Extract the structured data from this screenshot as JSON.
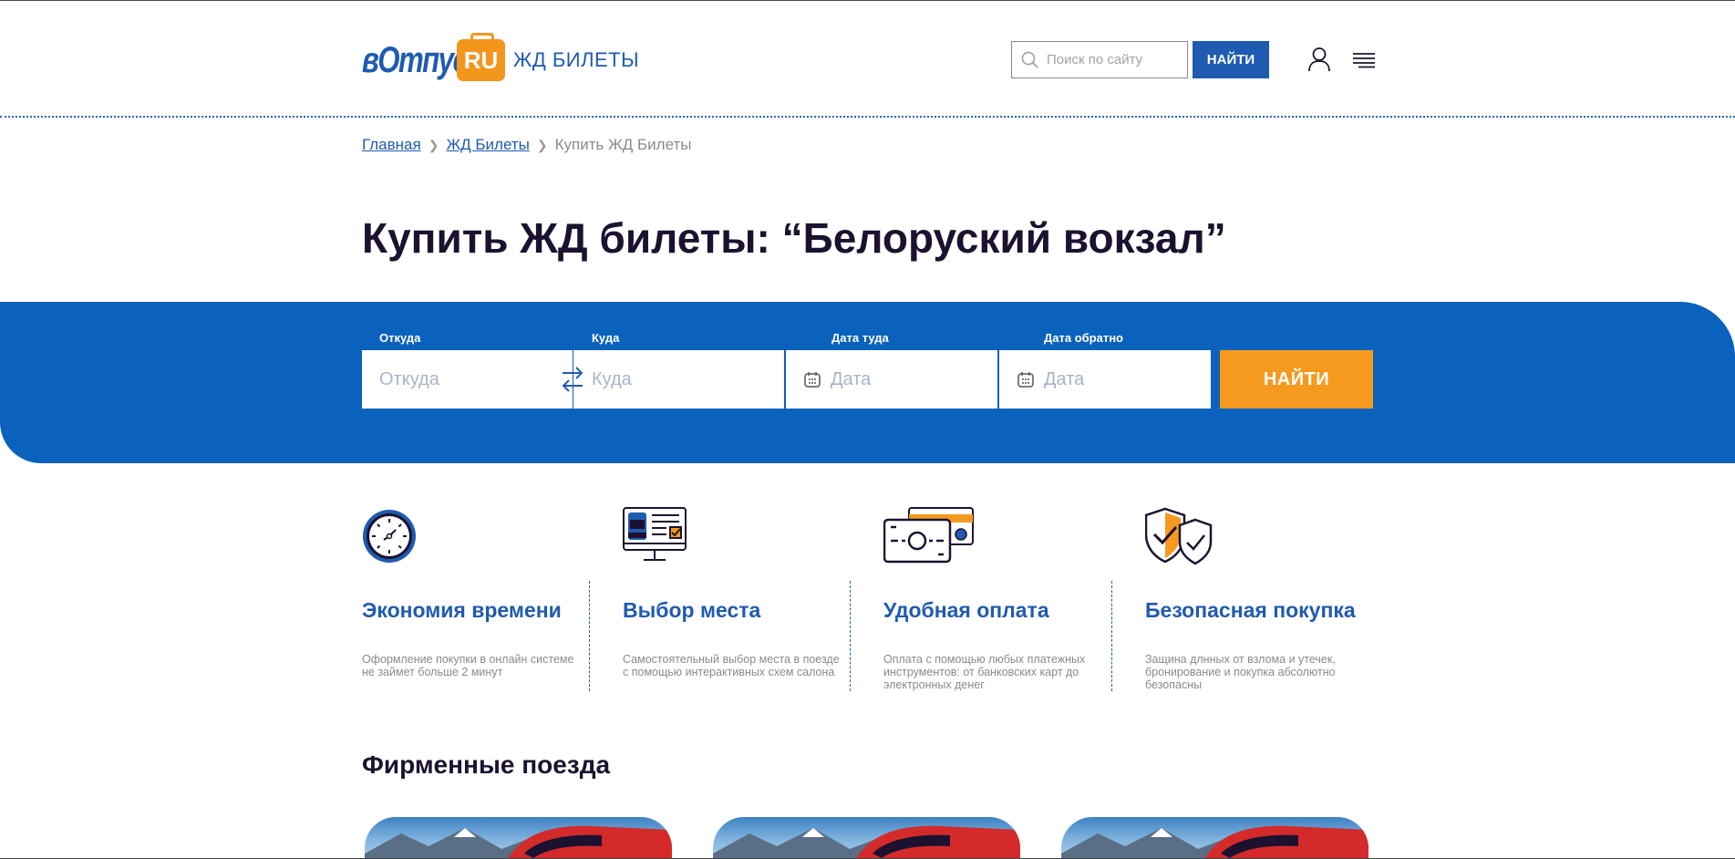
{
  "header": {
    "logo_word": "вОтпуск",
    "logo_badge": "RU",
    "logo_sub": "ЖД БИЛЕТЫ",
    "search_placeholder": "Поиск по сайту",
    "search_button": "НАЙТИ"
  },
  "breadcrumbs": [
    "Главная",
    "ЖД Билеты",
    "Купить ЖД Билеты"
  ],
  "page_title": "Купить ЖД билеты: “Белоруский вокзал”",
  "search_form": {
    "from_label": "Откуда",
    "from_placeholder": "Откуда",
    "to_label": "Куда",
    "to_placeholder": "Куда",
    "date_there_label": "Дата туда",
    "date_there_placeholder": "Дата",
    "date_back_label": "Дата обратно",
    "date_back_placeholder": "Дата",
    "submit": "НАЙТИ"
  },
  "features": [
    {
      "icon": "stopwatch-icon",
      "title": "Экономия времени",
      "text": "Оформление покупки в онлайн системе не займет больше 2 минут"
    },
    {
      "icon": "seat-monitor-icon",
      "title": "Выбор места",
      "text": "Самостоятельный выбор места в поезде с помощью интерактивных схем салона"
    },
    {
      "icon": "payment-cards-icon",
      "title": "Удобная оплата",
      "text": "Оплата с помощью любых платежных инструментов: от банковских карт до электронных денег"
    },
    {
      "icon": "shield-check-icon",
      "title": "Безопасная покупка",
      "text": "Защина длнных от взлома и утечек, бронирование и покупка абсолютно безопасны"
    }
  ],
  "branded_trains": {
    "title": "Фирменные поезда",
    "cards": [
      {
        "image": "train-photo"
      },
      {
        "image": "train-photo"
      },
      {
        "image": "train-photo"
      }
    ]
  },
  "colors": {
    "brand_blue": "#1f5bb0",
    "band_blue": "#0b62bd",
    "accent_orange": "#f69a1f"
  }
}
